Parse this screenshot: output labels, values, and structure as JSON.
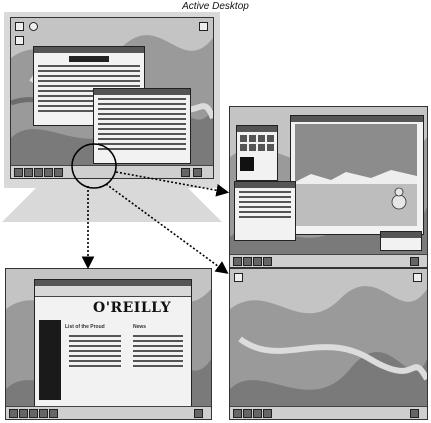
{
  "title": "Active Desktop",
  "panels": {
    "main": "desktop-with-text-windows",
    "right": "desktop-with-paint-application",
    "bottom_left": "desktop-with-web-browser",
    "bottom_right": "empty-desktop"
  },
  "browser": {
    "logo_text": "O'REILLY",
    "list_heading": "List of the Proud",
    "news_heading": "News"
  },
  "icons": [
    "monitor-icon",
    "magnifier-icon",
    "terminal-icon",
    "trash-icon"
  ],
  "colors": {
    "background": "#ffffff",
    "frame": "#d9d9d9",
    "desktop": "#9a9a9a",
    "arrow": "#000000"
  }
}
